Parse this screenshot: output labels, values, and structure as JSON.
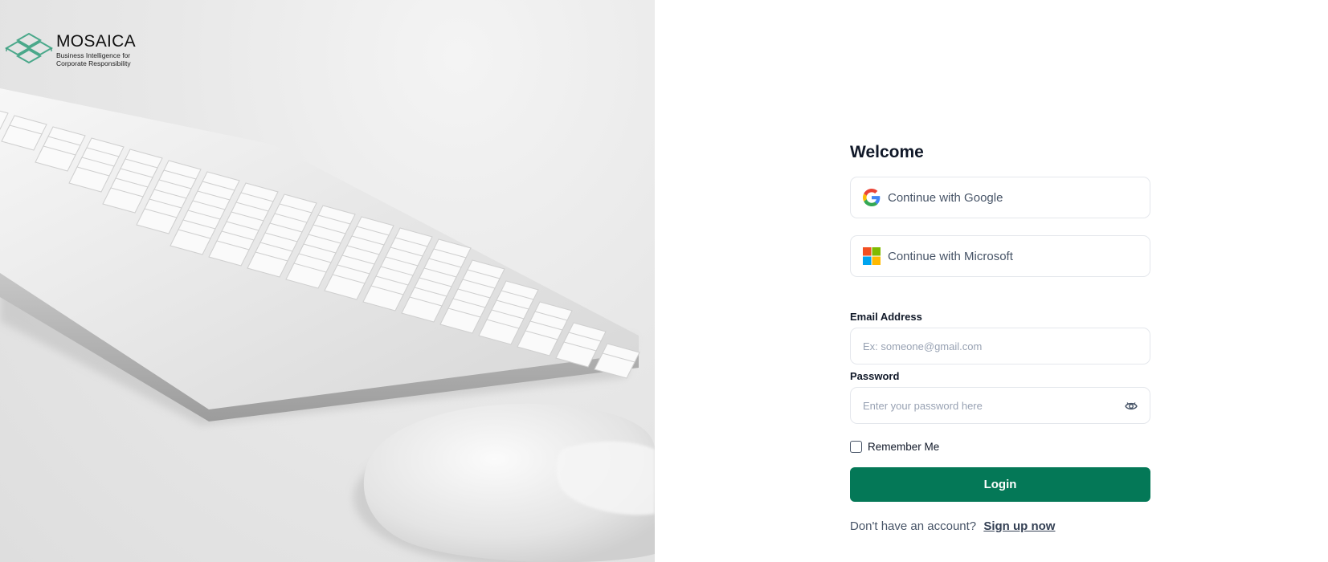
{
  "brand": {
    "name": "MOSAICA",
    "tagline_line1": "Business Intelligence for",
    "tagline_line2": "Corporate Responsibility",
    "accent": "#4aa88a"
  },
  "hero": {
    "image": "keyboard-and-mouse-photo"
  },
  "form": {
    "title": "Welcome",
    "google_label": "Continue with Google",
    "microsoft_label": "Continue with Microsoft",
    "email_label": "Email Address",
    "email_placeholder": "Ex: someone@gmail.com",
    "email_value": "",
    "password_label": "Password",
    "password_placeholder": "Enter your password here",
    "password_value": "",
    "remember_label": "Remember Me",
    "remember_checked": false,
    "login_label": "Login",
    "signup_prompt": "Don't have an account?",
    "signup_link": "Sign up now"
  },
  "colors": {
    "primary": "#047857",
    "border": "#e4e7ec",
    "text": "#101828",
    "muted": "#475467"
  },
  "icons": {
    "google": "google-logo-icon",
    "microsoft": "microsoft-logo-icon",
    "password_toggle": "eye-icon"
  }
}
